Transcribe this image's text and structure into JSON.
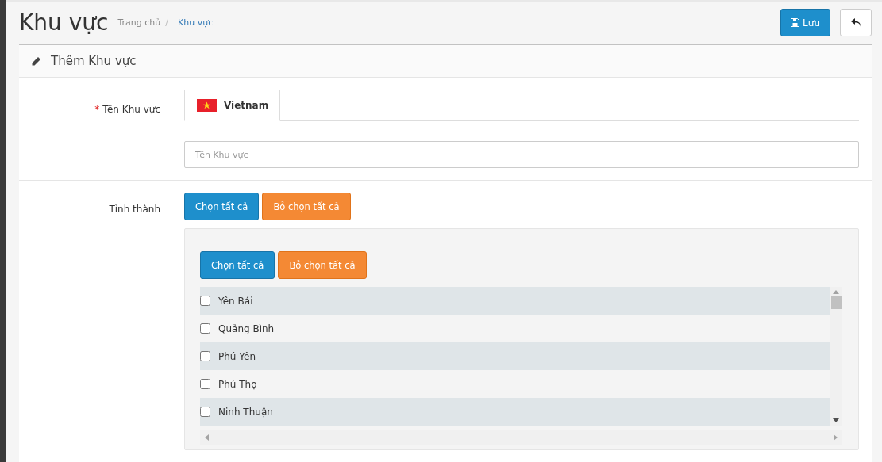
{
  "page": {
    "title": "Khu vực",
    "breadcrumb_separator": "/",
    "breadcrumb": [
      {
        "label": "Trang chủ",
        "selected": false
      },
      {
        "label": "Khu vực",
        "selected": true
      }
    ]
  },
  "actions": {
    "save": "Lưu"
  },
  "panel": {
    "title": "Thêm Khu vực"
  },
  "name_field": {
    "required_mark": "*",
    "label": "Tên Khu vực",
    "language_tabs": [
      {
        "label": "Vietnam",
        "selected": true
      }
    ],
    "placeholder": "Tên Khu vực"
  },
  "provinces": {
    "label": "Tỉnh thành",
    "select_all": "Chọn tất cả",
    "deselect_all": "Bỏ chọn tất cả",
    "inner_select_all": "Chọn tất cả",
    "inner_deselect_all": "Bỏ chọn tất cả",
    "items": [
      {
        "label": "Yên Bái",
        "checked": false
      },
      {
        "label": "Quảng Bình",
        "checked": false
      },
      {
        "label": "Phú Yên",
        "checked": false
      },
      {
        "label": "Phú Thọ",
        "checked": false
      },
      {
        "label": "Ninh Thuận",
        "checked": false
      }
    ]
  }
}
